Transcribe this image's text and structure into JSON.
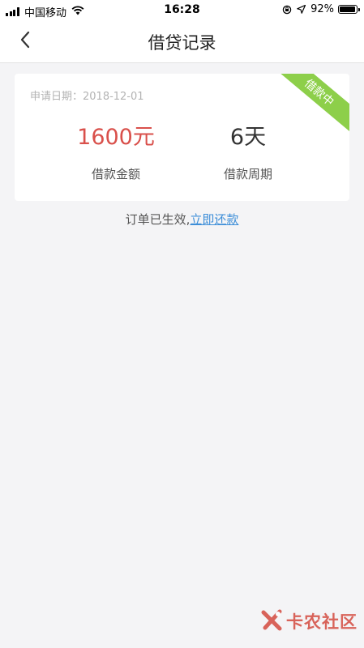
{
  "status_bar": {
    "carrier": "中国移动",
    "time": "16:28",
    "battery_percent": "92%",
    "battery_level": 0.92
  },
  "nav": {
    "title": "借贷记录",
    "back_icon": "chevron-left-icon"
  },
  "loan_card": {
    "apply_date": "申请日期：2018-12-01",
    "status_ribbon": "借款中",
    "status_color": "#8dcf4a",
    "amount_value": "1600元",
    "amount_label": "借款金额",
    "amount_color": "#d9504b",
    "term_value": "6天",
    "term_label": "借款周期"
  },
  "order_message": {
    "text": "订单已生效,",
    "link_label": "立即还款",
    "link_color": "#3d8ed8"
  },
  "watermark": {
    "text": "卡农社区"
  }
}
